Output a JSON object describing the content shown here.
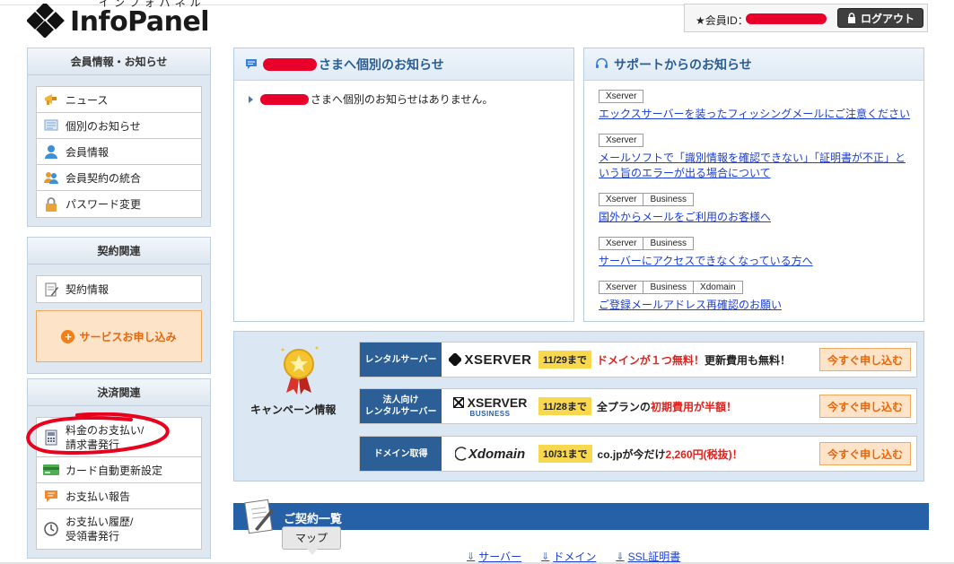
{
  "header": {
    "logo_kana": "インフォパネル",
    "logo_text": "InfoPanel",
    "member_label": "★会員ID：",
    "logout_label": "ログアウト"
  },
  "sidebar": {
    "account": {
      "title": "会員情報・お知らせ",
      "items": [
        {
          "label": "ニュース",
          "icon": "megaphone-icon"
        },
        {
          "label": "個別のお知らせ",
          "icon": "message-icon"
        },
        {
          "label": "会員情報",
          "icon": "user-icon"
        },
        {
          "label": "会員契約の統合",
          "icon": "users-merge-icon"
        },
        {
          "label": "パスワード変更",
          "icon": "lock-icon"
        }
      ]
    },
    "contract": {
      "title": "契約関連",
      "items": [
        {
          "label": "契約情報",
          "icon": "document-pen-icon"
        }
      ],
      "apply_label": "サービスお申し込み"
    },
    "payment": {
      "title": "決済関連",
      "items": [
        {
          "label": "料金のお支払い/\n請求書発行",
          "icon": "invoice-icon"
        },
        {
          "label": "カード自動更新設定",
          "icon": "credit-card-icon"
        },
        {
          "label": "お支払い報告",
          "icon": "chat-icon"
        },
        {
          "label": "お支払い履歴/\n受領書発行",
          "icon": "clock-icon"
        }
      ]
    }
  },
  "personal_notice": {
    "title_suffix": "さまへ個別のお知らせ",
    "message_suffix": "さまへ個別のお知らせはありません。"
  },
  "support": {
    "title": "サポートからのお知らせ",
    "items": [
      {
        "tags": [
          "Xserver"
        ],
        "text": "エックスサーバーを装ったフィッシングメールにご注意ください"
      },
      {
        "tags": [
          "Xserver"
        ],
        "text": "メールソフトで「識別情報を確認できない」「証明書が不正」と\nいう旨のエラーが出る場合について"
      },
      {
        "tags": [
          "Xserver",
          "Business"
        ],
        "text": "国外からメールをご利用のお客様へ"
      },
      {
        "tags": [
          "Xserver",
          "Business"
        ],
        "text": "サーバーにアクセスできなくなっている方へ"
      },
      {
        "tags": [
          "Xserver",
          "Business",
          "Xdomain"
        ],
        "text": "ご登録メールアドレス再確認のお願い"
      }
    ]
  },
  "campaign": {
    "label": "キャンペーン情報",
    "rows": [
      {
        "category": "レンタルサーバー",
        "brand": "XSERVER",
        "brand_sub": "",
        "date": "11/29まで",
        "text_red": "ドメインが１つ無料！",
        "text_tail": "更新費用も無料！",
        "text_head": "",
        "button": "今すぐ申し込む"
      },
      {
        "category": "法人向け\nレンタルサーバー",
        "brand": "XSERVER",
        "brand_sub": "BUSINESS",
        "date": "11/28まで",
        "text_head": "全プランの",
        "text_red": "初期費用が半額！",
        "text_tail": "",
        "button": "今すぐ申し込む"
      },
      {
        "category": "ドメイン取得",
        "brand": "Xdomain",
        "brand_sub": "",
        "date": "10/31まで",
        "text_head": "co.jpが今だけ",
        "text_red": "2,260円(税抜)！",
        "text_tail": "",
        "button": "今すぐ申し込む"
      }
    ]
  },
  "contracts": {
    "title": "ご契約一覧",
    "tooltip": "マップ",
    "anchors": [
      "サーバー",
      "ドメイン",
      "SSL証明書"
    ]
  },
  "colors": {
    "accent_blue": "#2660a6",
    "orange": "#e8660c",
    "redact": "#e8002a"
  }
}
